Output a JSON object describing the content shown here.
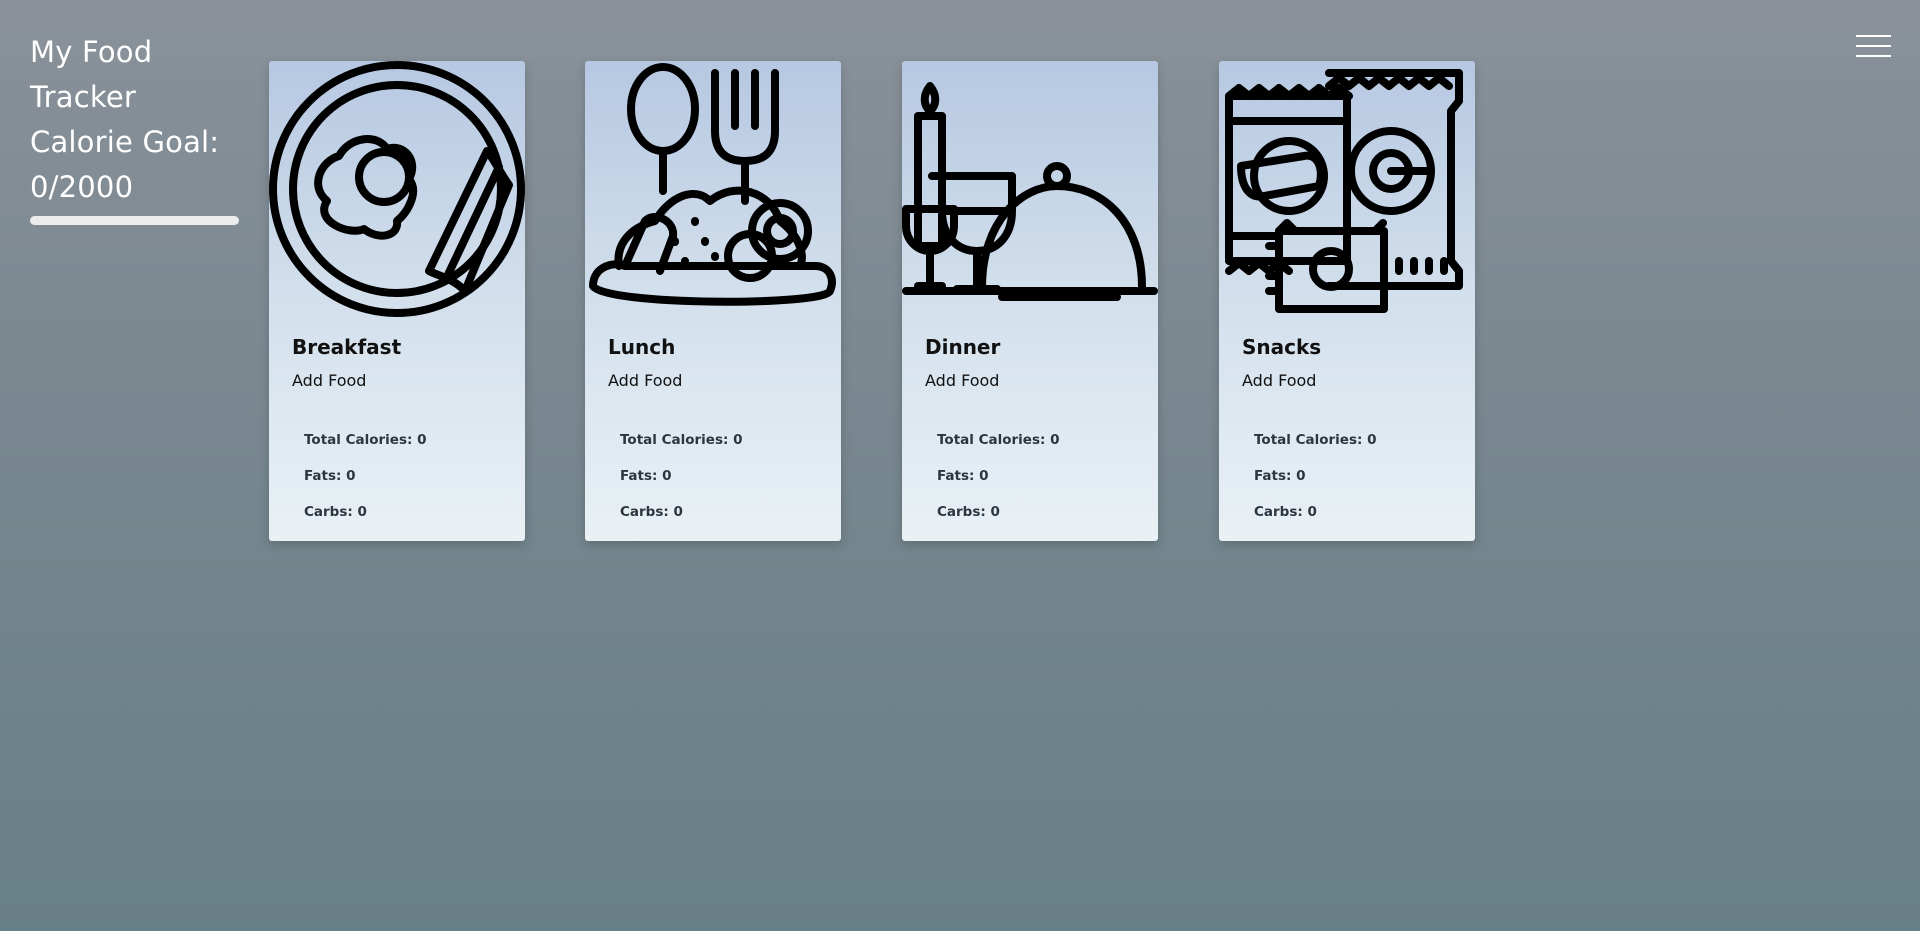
{
  "header": {
    "title_line_1": "My Food",
    "title_line_2": "Tracker",
    "goal_line_1": "Calorie Goal:",
    "goal_line_2": "0/2000",
    "progress_fraction": 0
  },
  "menu": {
    "icon": "hamburger-menu-icon"
  },
  "meals": [
    {
      "title": "Breakfast",
      "icon": "breakfast-plate-icon",
      "add_food": "Add Food",
      "total_calories": "Total Calories: 0",
      "fats": "Fats: 0",
      "carbs": "Carbs: 0"
    },
    {
      "title": "Lunch",
      "icon": "lunch-meal-icon",
      "add_food": "Add Food",
      "total_calories": "Total Calories: 0",
      "fats": "Fats: 0",
      "carbs": "Carbs: 0"
    },
    {
      "title": "Dinner",
      "icon": "dinner-cloche-icon",
      "add_food": "Add Food",
      "total_calories": "Total Calories: 0",
      "fats": "Fats: 0",
      "carbs": "Carbs: 0"
    },
    {
      "title": "Snacks",
      "icon": "snacks-bags-icon",
      "add_food": "Add Food",
      "total_calories": "Total Calories: 0",
      "fats": "Fats: 0",
      "carbs": "Carbs: 0"
    }
  ],
  "colors": {
    "text_primary": "#ffffff",
    "card_text": "#111111",
    "stat_text": "#2d3540",
    "progress_track": "#ececec"
  }
}
